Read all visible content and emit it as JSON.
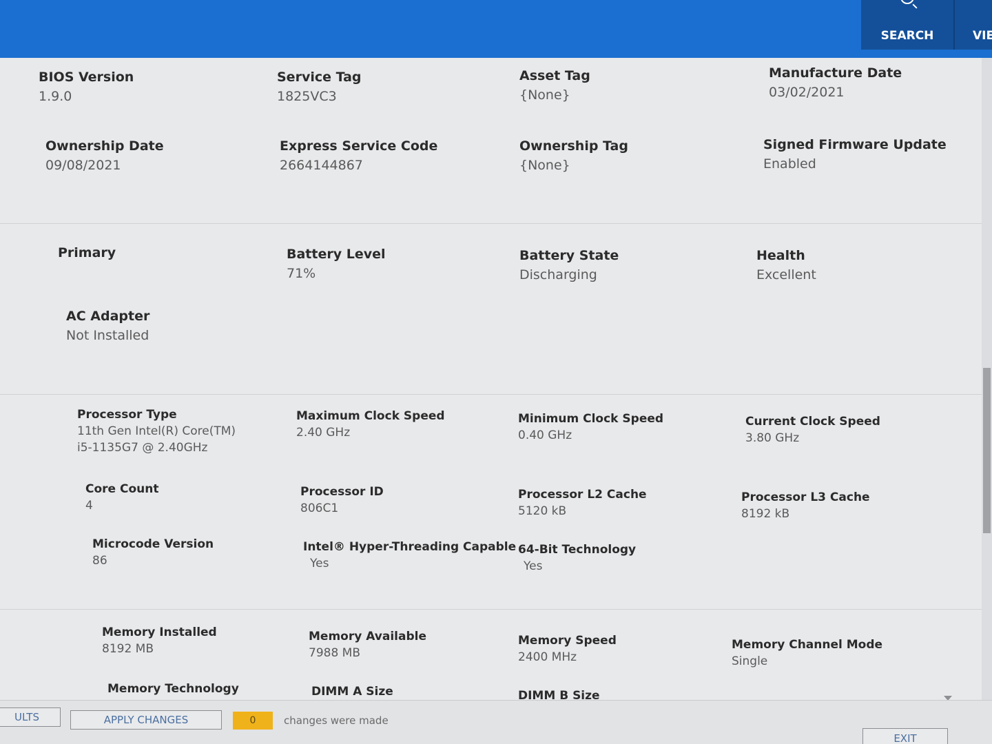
{
  "header": {
    "search_label": "SEARCH",
    "view_label": "VIE",
    "colors": {
      "bar": "#1a6fd0",
      "button": "#14509a"
    }
  },
  "system": {
    "bios_version": {
      "label": "BIOS Version",
      "value": "1.9.0"
    },
    "service_tag": {
      "label": "Service Tag",
      "value": "1825VC3"
    },
    "asset_tag": {
      "label": "Asset Tag",
      "value": "{None}"
    },
    "manufacture_date": {
      "label": "Manufacture Date",
      "value": "03/02/2021"
    },
    "ownership_date": {
      "label": "Ownership Date",
      "value": "09/08/2021"
    },
    "express_service_code": {
      "label": "Express Service Code",
      "value": "2664144867"
    },
    "ownership_tag": {
      "label": "Ownership Tag",
      "value": "{None}"
    },
    "signed_firmware_update": {
      "label": "Signed Firmware Update",
      "value": "Enabled"
    }
  },
  "battery": {
    "primary": {
      "label": "Primary"
    },
    "battery_level": {
      "label": "Battery Level",
      "value": "71%"
    },
    "battery_state": {
      "label": "Battery State",
      "value": "Discharging"
    },
    "health": {
      "label": "Health",
      "value": "Excellent"
    },
    "ac_adapter": {
      "label": "AC Adapter",
      "value": "Not Installed"
    }
  },
  "processor": {
    "type": {
      "label": "Processor Type",
      "value_line1": "11th Gen Intel(R) Core(TM)",
      "value_line2": "i5-1135G7 @ 2.40GHz"
    },
    "max_clock": {
      "label": "Maximum Clock Speed",
      "value": "2.40 GHz"
    },
    "min_clock": {
      "label": "Minimum Clock Speed",
      "value": "0.40 GHz"
    },
    "current_clock": {
      "label": "Current Clock Speed",
      "value": "3.80 GHz"
    },
    "core_count": {
      "label": "Core Count",
      "value": "4"
    },
    "processor_id": {
      "label": "Processor ID",
      "value": "806C1"
    },
    "l2_cache": {
      "label": "Processor L2 Cache",
      "value": "5120 kB"
    },
    "l3_cache": {
      "label": "Processor L3 Cache",
      "value": "8192 kB"
    },
    "microcode": {
      "label": "Microcode Version",
      "value": "86"
    },
    "hyperthreading": {
      "label": "Intel® Hyper-Threading Capable",
      "value": "Yes"
    },
    "bit64": {
      "label": "64-Bit Technology",
      "value": "Yes"
    }
  },
  "memory": {
    "installed": {
      "label": "Memory Installed",
      "value": "8192 MB"
    },
    "available": {
      "label": "Memory Available",
      "value": "7988 MB"
    },
    "speed": {
      "label": "Memory Speed",
      "value": "2400 MHz"
    },
    "channel_mode": {
      "label": "Memory Channel Mode",
      "value": "Single"
    },
    "technology": {
      "label": "Memory Technology"
    },
    "dimm_a": {
      "label": "DIMM A Size"
    },
    "dimm_b": {
      "label": "DIMM B Size"
    }
  },
  "footer": {
    "defaults_label": "ULTS",
    "apply_label": "APPLY CHANGES",
    "change_count": "0",
    "change_text": "changes were made",
    "exit_label": "EXIT",
    "count_color": "#f0b21a"
  }
}
